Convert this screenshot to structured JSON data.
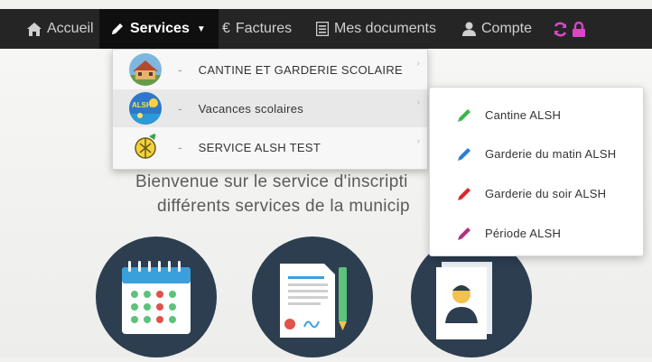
{
  "nav": {
    "home_label": "Accueil",
    "services_label": "Services",
    "invoices_label": "Factures",
    "documents_label": "Mes documents",
    "account_label": "Compte"
  },
  "services_menu": {
    "items": [
      {
        "label": "CANTINE ET GARDERIE SCOLAIRE"
      },
      {
        "label": "Vacances scolaires"
      },
      {
        "label": "SERVICE ALSH TEST"
      }
    ],
    "separator": "-"
  },
  "submenu": {
    "items": [
      {
        "label": "Cantine ALSH",
        "color": "#3db54a"
      },
      {
        "label": "Garderie du matin ALSH",
        "color": "#2a7fd6"
      },
      {
        "label": "Garderie du soir ALSH",
        "color": "#e0242d"
      },
      {
        "label": "Période ALSH",
        "color": "#b0337d"
      }
    ]
  },
  "welcome": {
    "line1": "Bienvenue sur le service d'inscripti",
    "line2": "différents services de la municip"
  },
  "colors": {
    "navbar": "#252525",
    "active_tab": "#0f0f0f",
    "refresh_icon": "#d946c8",
    "circle": "#2c3e50"
  }
}
